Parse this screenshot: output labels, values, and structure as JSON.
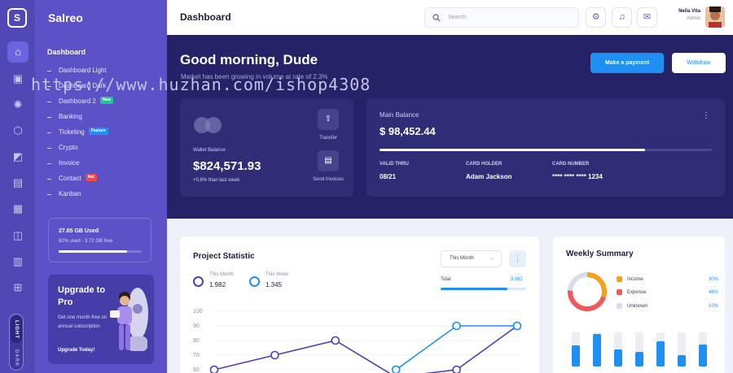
{
  "app": {
    "name": "Salreo",
    "page_title": "Dashboard"
  },
  "rail": {
    "mode_light": "LIGHT",
    "mode_dark": "DARK"
  },
  "sidebar": {
    "section": "Dashboard",
    "items": [
      {
        "label": "Dashboard Light",
        "badge": null
      },
      {
        "label": "Dashboard Dark",
        "badge": null
      },
      {
        "label": "Dashboard 2",
        "badge": "New",
        "badge_color": "#22c393"
      },
      {
        "label": "Banking",
        "badge": null
      },
      {
        "label": "Ticketing",
        "badge": "Feature",
        "badge_color": "#1f8ff4"
      },
      {
        "label": "Crypto",
        "badge": null
      },
      {
        "label": "Invoice",
        "badge": null
      },
      {
        "label": "Contact",
        "badge": "Hot",
        "badge_color": "#ef4545"
      },
      {
        "label": "Kanban",
        "badge": null
      }
    ],
    "storage": {
      "title": "27.65 GB Used",
      "subtitle": "82% used - 3.72 GB free",
      "percent": 82
    },
    "promo": {
      "title": "Upgrade to Pro",
      "text": "Get one month free on annual subscription",
      "cta": "Upgrade Today!"
    }
  },
  "topbar": {
    "search_placeholder": "Search",
    "user_name": "Nella Vita",
    "user_role": "Admin"
  },
  "hero": {
    "greeting": "Good morning, Dude",
    "subtitle": "Market has been growing in volume at rate of 2.3%",
    "make_payment": "Make a payment",
    "withdraw": "Withdraw"
  },
  "wallet": {
    "label": "Wallet Balance",
    "amount": "$824,571.93",
    "change": "+0,8% than last week",
    "transfer": "Transfer",
    "send_invoices": "Send Invoices"
  },
  "main_balance": {
    "label": "Main Balance",
    "amount": "$ 98,452.44",
    "progress": 0.8,
    "valid_thru_label": "VALID THRU",
    "valid_thru": "08/21",
    "card_holder_label": "CARD HOLDER",
    "card_holder": "Adam Jackson",
    "card_number_label": "CARD NUMBER",
    "card_number": "**** **** **** 1234"
  },
  "project": {
    "title": "Project Statistic",
    "period": "This Month",
    "legend": [
      {
        "label": "This Month",
        "value": "1.982",
        "color": "#4a3fb0"
      },
      {
        "label": "This Week",
        "value": "1.345",
        "color": "#1f8ff4"
      }
    ],
    "total_label": "Total",
    "total_value": "3.982",
    "total_percent": 78
  },
  "chart_data": {
    "type": "line",
    "y_ticks": [
      "100",
      "90",
      "80",
      "70",
      "60"
    ],
    "ylim": [
      56,
      100
    ],
    "series": [
      {
        "name": "This Month",
        "color": "#4a3fb0",
        "values": [
          60,
          70,
          80,
          55,
          60,
          90
        ]
      },
      {
        "name": "This Week",
        "color": "#1f8ff4",
        "values": [
          null,
          null,
          null,
          60,
          90,
          90
        ]
      }
    ]
  },
  "weekly": {
    "title": "Weekly Summary",
    "legend": [
      {
        "label": "Income",
        "value": "30%",
        "color": "#f5a01a"
      },
      {
        "label": "Expense",
        "value": "46%",
        "color": "#ef5b5b"
      },
      {
        "label": "Unknown",
        "value": "10%",
        "color": "#d9dde8"
      }
    ],
    "bars": [
      {
        "back": 42,
        "front": 26
      },
      {
        "back": 42,
        "front": 40
      },
      {
        "back": 42,
        "front": 21
      },
      {
        "back": 42,
        "front": 18
      },
      {
        "back": 42,
        "front": 31
      },
      {
        "back": 42,
        "front": 14
      },
      {
        "back": 42,
        "front": 27
      }
    ]
  },
  "watermark": "https://www.huzhan.com/ishop4308"
}
